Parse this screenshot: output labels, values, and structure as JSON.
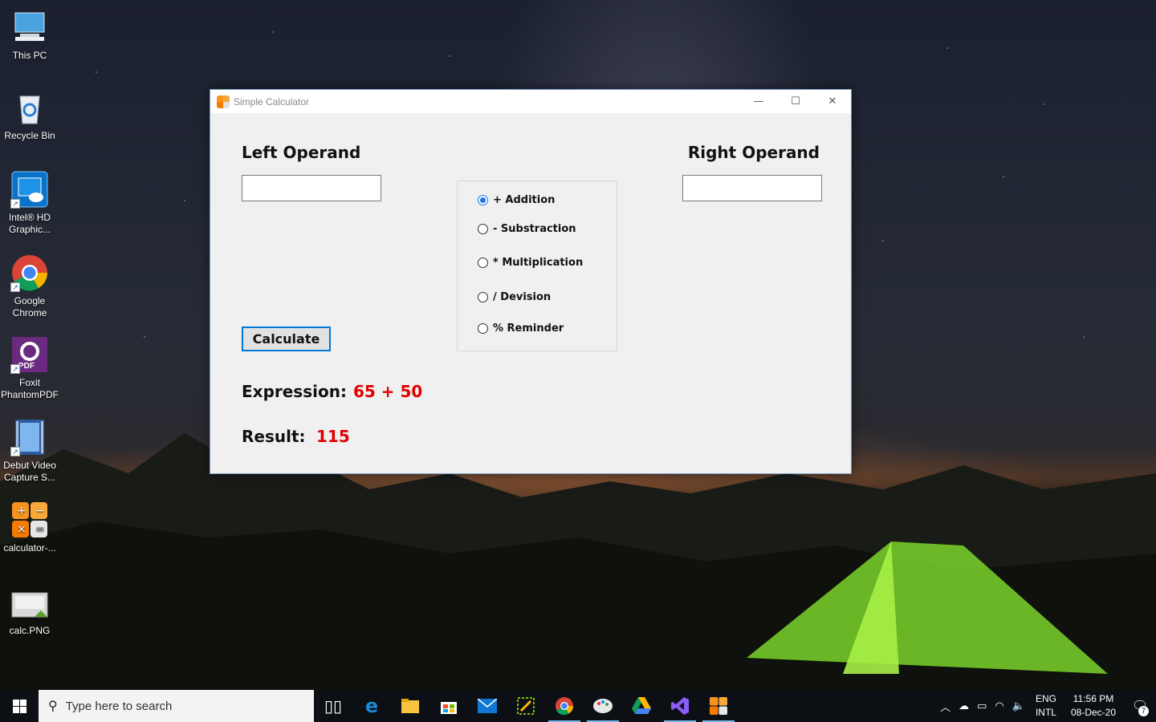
{
  "desktop": {
    "icons": [
      {
        "label": "This PC"
      },
      {
        "label": "Recycle Bin"
      },
      {
        "label": "Intel® HD Graphic..."
      },
      {
        "label": "Google Chrome"
      },
      {
        "label": "Foxit PhantomPDF"
      },
      {
        "label": "Debut Video Capture S..."
      },
      {
        "label": "calculator-..."
      },
      {
        "label": "calc.PNG"
      }
    ],
    "pdf_badge": "PDF"
  },
  "window": {
    "title": "Simple Calculator",
    "controls": {
      "minimize": "—",
      "maximize": "☐",
      "close": "✕"
    }
  },
  "form": {
    "left_label": "Left Operand",
    "right_label": "Right Operand",
    "left_value": "",
    "right_value": "",
    "operations": [
      {
        "label": "+ Addition",
        "checked": true
      },
      {
        "label": "- Substraction",
        "checked": false
      },
      {
        "label": "* Multiplication",
        "checked": false
      },
      {
        "label": "/ Devision",
        "checked": false
      },
      {
        "label": "% Reminder",
        "checked": false
      }
    ],
    "calculate_label": "Calculate",
    "expression_label": "Expression:",
    "expression_value": "65 + 50",
    "result_label": "Result:",
    "result_value": "115",
    "value_color": "#e00000",
    "accent_color": "#0078d7"
  },
  "taskbar": {
    "search_placeholder": "Type here to search",
    "apps": [
      {
        "name": "task-view-icon",
        "active": false
      },
      {
        "name": "edge-icon",
        "active": false
      },
      {
        "name": "file-explorer-icon",
        "active": false
      },
      {
        "name": "store-icon",
        "active": false
      },
      {
        "name": "mail-icon",
        "active": false
      },
      {
        "name": "snip-tool-icon",
        "active": false
      },
      {
        "name": "chrome-icon",
        "active": true
      },
      {
        "name": "paint-icon",
        "active": true
      },
      {
        "name": "google-drive-icon",
        "active": false
      },
      {
        "name": "visual-studio-icon",
        "active": true
      },
      {
        "name": "calculator-icon",
        "active": true
      }
    ],
    "tray": {
      "lang_top": "ENG",
      "lang_bottom": "INTL",
      "time": "11:56 PM",
      "date": "08-Dec-20",
      "notification_count": "7"
    }
  }
}
